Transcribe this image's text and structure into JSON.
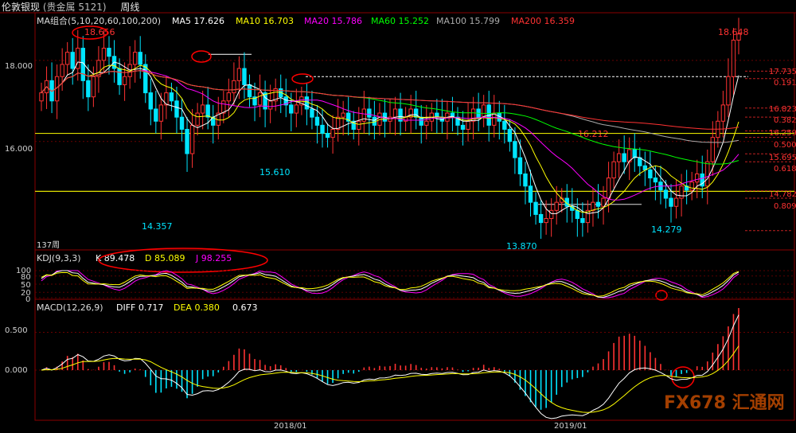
{
  "window": {
    "title": "伦敦银现",
    "subtitle": "(贵金属 5121)",
    "period": "周线"
  },
  "legend": {
    "ma_group": "MA组合(5,10,20,60,100,200)",
    "ma5": "MA5 17.626",
    "ma10": "MA10 16.703",
    "ma20": "MA20 15.786",
    "ma60": "MA60 15.252",
    "ma100": "MA100 15.799",
    "ma200": "MA200 16.359",
    "count": "137周",
    "kdj": "KDJ(9,3,3)",
    "k": "K 89.478",
    "d": "D 85.089",
    "j": "J 98.255",
    "macd": "MACD(12,26,9)",
    "diff": "DIFF 0.717",
    "dea": "DEA 0.380",
    "macd_val": "0.673"
  },
  "colors": {
    "up": "#ff3232",
    "down": "#00e5ff",
    "ma5": "#ffffff",
    "ma10": "#ffff00",
    "ma20": "#ff00ff",
    "ma60": "#00ff00",
    "ma100": "#aaaaaa",
    "ma200": "#ff3232",
    "highlight": "#ff0000"
  },
  "price_axis": [
    "18.000",
    "16.000"
  ],
  "kdj_axis": [
    "100",
    "80",
    "50",
    "20",
    "0"
  ],
  "macd_axis": [
    "0.500",
    "0.000"
  ],
  "time_axis": [
    "2018/01",
    "2019/01"
  ],
  "annotations": {
    "high1": "18.656",
    "high2": "18.648",
    "low1": "14.357",
    "low2": "15.610",
    "low3": "13.870",
    "low4": "14.279",
    "mid": "16.212"
  },
  "fib_labels": [
    "17.735",
    "0.191",
    "16.823",
    "0.382",
    "16.259",
    "0.500",
    "15.695",
    "0.618",
    "14.782",
    "0.809"
  ],
  "watermark": "FX678 汇通网",
  "chart_data": {
    "type": "candlestick",
    "title": "伦敦银现 周线",
    "ylim": [
      13.6,
      18.9
    ],
    "series": [
      {
        "name": "MA5",
        "last": 17.626
      },
      {
        "name": "MA10",
        "last": 16.703
      },
      {
        "name": "MA20",
        "last": 15.786
      },
      {
        "name": "MA60",
        "last": 15.252
      },
      {
        "name": "MA100",
        "last": 15.799
      },
      {
        "name": "MA200",
        "last": 16.359
      }
    ],
    "closes": [
      17.2,
      17.5,
      17.0,
      17.6,
      17.9,
      18.2,
      17.8,
      18.3,
      17.5,
      17.1,
      17.6,
      18.0,
      18.3,
      18.1,
      17.8,
      17.4,
      17.6,
      17.9,
      18.2,
      17.9,
      17.2,
      16.8,
      16.5,
      16.9,
      17.2,
      17.0,
      16.6,
      16.3,
      15.7,
      16.4,
      16.7,
      16.9,
      16.6,
      16.4,
      16.7,
      17.0,
      17.2,
      17.5,
      17.8,
      17.4,
      17.1,
      16.9,
      17.2,
      16.8,
      17.0,
      17.3,
      17.1,
      16.9,
      16.7,
      16.9,
      17.1,
      16.8,
      16.6,
      16.4,
      16.2,
      16.1,
      16.3,
      16.6,
      16.7,
      16.5,
      16.3,
      16.5,
      16.8,
      16.6,
      16.4,
      16.7,
      16.5,
      16.6,
      16.8,
      16.5,
      16.6,
      16.8,
      16.6,
      16.4,
      16.5,
      16.7,
      16.6,
      16.5,
      16.7,
      16.6,
      16.4,
      16.3,
      16.5,
      16.8,
      16.6,
      16.9,
      16.4,
      16.7,
      16.5,
      16.3,
      16.0,
      15.6,
      15.2,
      14.9,
      14.5,
      14.2,
      14.0,
      14.1,
      14.3,
      14.5,
      14.6,
      14.4,
      14.3,
      14.1,
      14.0,
      14.3,
      14.5,
      14.4,
      14.6,
      15.1,
      15.5,
      15.7,
      15.5,
      15.8,
      15.6,
      15.4,
      15.3,
      15.1,
      15.0,
      14.8,
      14.6,
      14.4,
      14.6,
      14.9,
      14.8,
      15.0,
      15.2,
      14.9,
      15.5,
      16.1,
      16.5,
      16.9,
      17.6,
      18.5,
      18.65
    ],
    "kdj": {
      "k": 89.478,
      "d": 85.089,
      "j": 98.255
    },
    "macd": {
      "diff": 0.717,
      "dea": 0.38,
      "macd": 0.673
    }
  }
}
